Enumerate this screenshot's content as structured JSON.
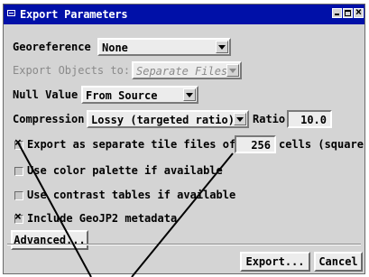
{
  "window": {
    "title": "Export Parameters"
  },
  "georeference": {
    "label": "Georeference",
    "value": "None"
  },
  "export_objects": {
    "label": "Export Objects to:",
    "value": "Separate Files"
  },
  "null_value": {
    "label": "Null Value",
    "value": "From Source"
  },
  "compression": {
    "label": "Compression",
    "value": "Lossy (targeted ratio)",
    "ratio_label": "Ratio",
    "ratio_value": "10.0"
  },
  "tile": {
    "label_before": "Export as separate tile files of",
    "value": "256",
    "label_after": "cells (square)",
    "checked": true
  },
  "palette": {
    "label": "Use color palette if available",
    "checked": false
  },
  "contrast": {
    "label": "Use contrast tables if available",
    "checked": false
  },
  "geojp2": {
    "label": "Include GeoJP2 metadata",
    "checked": true
  },
  "buttons": {
    "advanced": "Advanced...",
    "export": "Export...",
    "cancel": "Cancel"
  }
}
